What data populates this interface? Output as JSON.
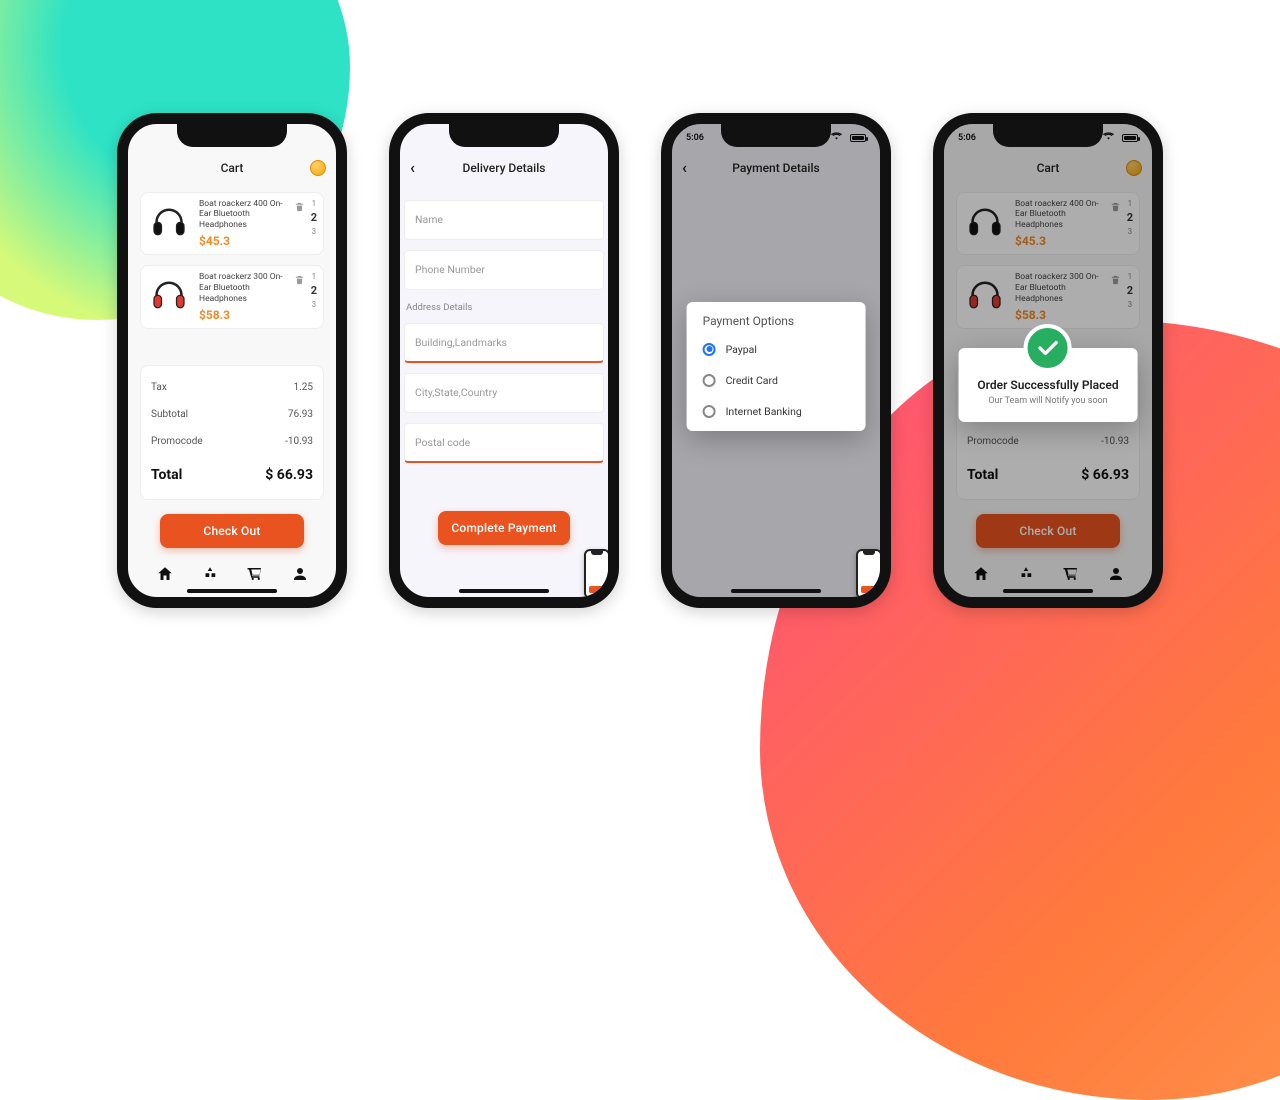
{
  "status_time": "5:06",
  "colors": {
    "accent": "#e9531f",
    "success": "#27ae60",
    "coin": "#f2a40c"
  },
  "cart": {
    "title": "Cart",
    "items": [
      {
        "name": "Boat roackerz 400 On-Ear Bluetooth Headphones",
        "price": "$45.3",
        "qty_up": "1",
        "qty": "2",
        "qty_down": "3",
        "color": "#111"
      },
      {
        "name": "Boat roackerz 300 On-Ear Bluetooth Headphones",
        "price": "$58.3",
        "qty_up": "1",
        "qty": "2",
        "qty_down": "3",
        "color": "#e03a30"
      }
    ],
    "totals": {
      "tax_label": "Tax",
      "tax": "1.25",
      "subtotal_label": "Subtotal",
      "subtotal": "76.93",
      "promo_label": "Promocode",
      "promo": "-10.93",
      "total_label": "Total",
      "total": "$ 66.93"
    },
    "checkout_label": "Check Out"
  },
  "delivery": {
    "title": "Delivery Details",
    "name_ph": "Name",
    "phone_ph": "Phone Number",
    "address_section": "Address Details",
    "building_ph": "Building,Landmarks",
    "city_ph": "City,State,Country",
    "postal_ph": "Postal code",
    "complete_label": "Complete Payment"
  },
  "payment": {
    "title": "Payment Details",
    "modal_title": "Payment Options",
    "options": [
      {
        "label": "Paypal",
        "selected": true
      },
      {
        "label": "Credit Card",
        "selected": false
      },
      {
        "label": "Internet Banking",
        "selected": false
      }
    ]
  },
  "success": {
    "title": "Order Successfully Placed",
    "subtitle": "Our Team will Notify you soon"
  }
}
